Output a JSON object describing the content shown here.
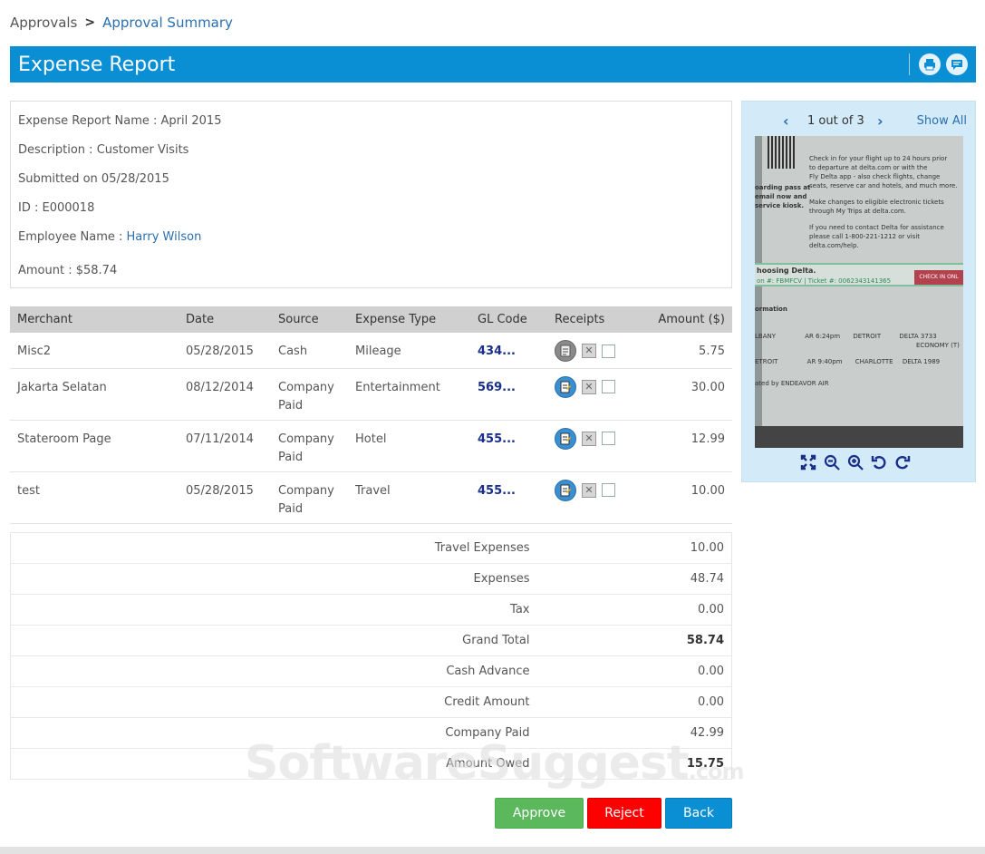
{
  "breadcrumb": {
    "root": "Approvals",
    "separator": ">",
    "current": "Approval Summary"
  },
  "header": {
    "title": "Expense Report",
    "icons": [
      "print-icon",
      "comment-icon"
    ]
  },
  "report": {
    "name_label": "Expense Report Name : ",
    "name": "April 2015",
    "description_label": "Description : ",
    "description": "Customer Visits",
    "submitted": "Submitted on 05/28/2015",
    "id_label": "ID : ",
    "id": "E000018",
    "employee_label": "Employee Name : ",
    "employee": "Harry Wilson",
    "amount_label": "Amount : ",
    "amount": "$58.74"
  },
  "receipt_viewer": {
    "prev": "‹",
    "page": "1 out of 3",
    "next": "›",
    "show_all": "Show All",
    "receipt_text": {
      "line1": "Check in for your flight up to 24 hours prior",
      "line2": "to departure at delta.com or with the",
      "line3": "Fly Delta app - also check flights, change",
      "line4": "seats, reserve car and hotels, and much more.",
      "line5": "Make changes to eligible electronic tickets",
      "line6": "through My Trips at delta.com.",
      "line7": "If you need to contact Delta for assistance",
      "line8": "please call 1-800-221-1212 or visit delta.com/help.",
      "boarding": "oarding pass at",
      "boarding2": "email now and",
      "boarding3": "service kiosk.",
      "choosing": "hoosing Delta.",
      "confirm": "on #: FBMFCV | Ticket #: 0062343141365",
      "checkin": "CHECK IN ONL",
      "information": "ormation",
      "leg1_from": "LBANY",
      "leg1_time": "AR 6:24pm",
      "leg1_to": "DETROIT",
      "leg1_flight": "DELTA 3733",
      "leg2_from": "ETROIT",
      "leg2_time": "AR 9:40pm",
      "leg2_to": "CHARLOTTE",
      "leg2_flight": "DELTA 1989",
      "economy": "ECONOMY (T)",
      "operated": "ated by ENDEAVOR AIR"
    }
  },
  "items_table": {
    "columns": [
      "Merchant",
      "Date",
      "Source",
      "Expense Type",
      "GL Code",
      "Receipts",
      "Amount ($)"
    ],
    "rows": [
      {
        "merchant": "Misc2",
        "date": "05/28/2015",
        "source": "Cash",
        "type": "Mileage",
        "gl": "434...",
        "amount": "5.75",
        "receipt_icon": "receipt-grey-icon"
      },
      {
        "merchant": "Jakarta Selatan",
        "date": "08/12/2014",
        "source": "Company Paid",
        "type": "Entertainment",
        "gl": "569...",
        "amount": "30.00",
        "receipt_icon": "receipt-attached-icon"
      },
      {
        "merchant": "Stateroom Page",
        "date": "07/11/2014",
        "source": "Company Paid",
        "type": "Hotel",
        "gl": "455...",
        "amount": "12.99",
        "receipt_icon": "receipt-attached-icon"
      },
      {
        "merchant": "test",
        "date": "05/28/2015",
        "source": "Company Paid",
        "type": "Travel",
        "gl": "455...",
        "amount": "10.00",
        "receipt_icon": "receipt-attached-icon"
      }
    ]
  },
  "totals": [
    {
      "label": "Travel Expenses",
      "value": "10.00"
    },
    {
      "label": "Expenses",
      "value": "48.74"
    },
    {
      "label": "Tax",
      "value": "0.00"
    },
    {
      "label": "Grand Total",
      "value": "58.74"
    },
    {
      "label": "Cash Advance",
      "value": "0.00"
    },
    {
      "label": "Credit Amount",
      "value": "0.00"
    },
    {
      "label": "Company Paid",
      "value": "42.99"
    },
    {
      "label": "Amount Owed",
      "value": "15.75"
    }
  ],
  "watermark": {
    "main": "SoftwareSuggest",
    "suffix": ".com"
  },
  "actions": {
    "approve": "Approve",
    "reject": "Reject",
    "back": "Back"
  },
  "colors": {
    "header_bg": "#0a8fd4",
    "approve": "#5cb85c",
    "reject": "#ff0000",
    "back": "#0a8fd4",
    "link": "#2a6fb0"
  }
}
